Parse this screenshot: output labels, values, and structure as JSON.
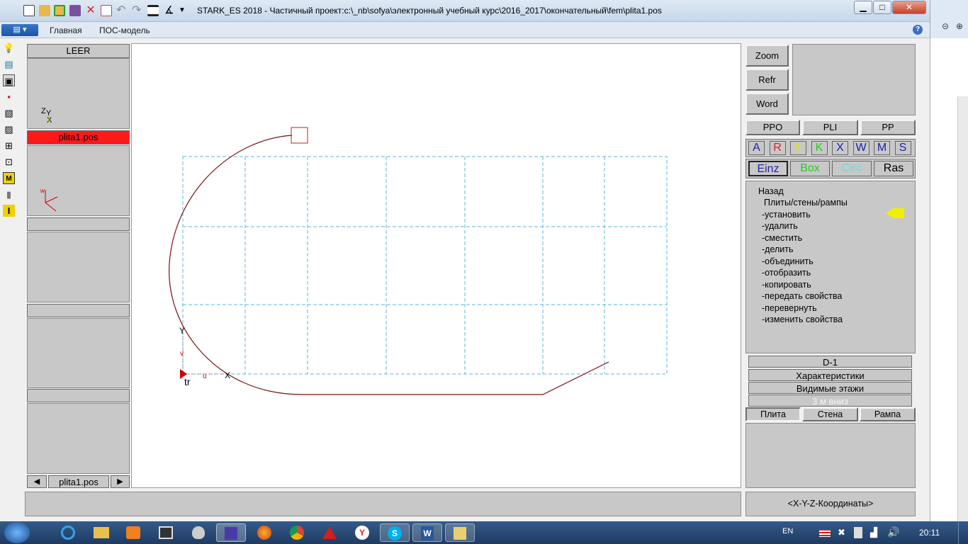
{
  "window": {
    "title": "STARK_ES 2018 - Частичный проект:c:\\_nb\\sofya\\электронный учебный курс\\2016_2017\\окончательный\\fem\\plita1.pos",
    "minimize": "▁",
    "maximize": "□",
    "close": "✕"
  },
  "ribbon": {
    "tabs": [
      "Главная",
      "ПОС-модель"
    ],
    "help": "?"
  },
  "left_panel": {
    "header": "LEER",
    "active_file": "plita1.pos",
    "axis_labels": [
      "Z",
      "Y",
      "X"
    ],
    "nav_file": "plita1.pos"
  },
  "right_panel": {
    "tools": [
      "Zoom",
      "Refr",
      "Word"
    ],
    "modes": [
      "PPO",
      "PLI",
      "PP"
    ],
    "letters": [
      {
        "t": "A",
        "c": "#2222aa"
      },
      {
        "t": "R",
        "c": "#dd2222"
      },
      {
        "t": "F",
        "c": "#e0e000"
      },
      {
        "t": "K",
        "c": "#22cc22"
      },
      {
        "t": "X",
        "c": "#2222aa"
      },
      {
        "t": "W",
        "c": "#2222aa"
      },
      {
        "t": "M",
        "c": "#2222aa"
      },
      {
        "t": "S",
        "c": "#2222aa"
      }
    ],
    "shapes": [
      {
        "t": "Einz",
        "c": "#2222aa"
      },
      {
        "t": "Box",
        "c": "#22cc22"
      },
      {
        "t": "Circ",
        "c": "#66dddd"
      },
      {
        "t": "Ras",
        "c": "#000000"
      }
    ],
    "menu": {
      "back": "Назад",
      "section": "Плиты/стены/рампы",
      "items": [
        "-установить",
        "-удалить",
        "-сместить",
        "-делить",
        "-объединить",
        "-отобразить",
        "-копировать",
        "-передать свойства",
        "-перевернуть",
        "-изменить свойства"
      ]
    },
    "level": "D-1",
    "characteristics": "Характеристики",
    "visible_floors": "Видимые этажи",
    "down": "3 м вниз",
    "elements": [
      "Плита",
      "Стена",
      "Рампа"
    ],
    "coords": "<X-Y-Z-Координаты>"
  },
  "canvas": {
    "axis_y": "Y",
    "axis_x": "X",
    "label_v": "v",
    "label_u": "u"
  },
  "taskbar": {
    "lang": "EN",
    "time": "20:11"
  }
}
